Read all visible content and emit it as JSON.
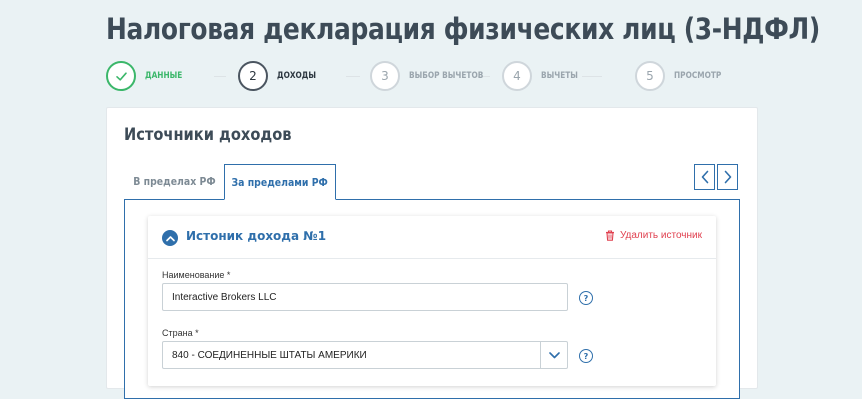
{
  "page": {
    "title": "Налоговая декларация физических лиц (3-НДФЛ)"
  },
  "steps": [
    {
      "number": "✓",
      "label": "ДАННЫЕ",
      "state": "done"
    },
    {
      "number": "2",
      "label": "ДОХОДЫ",
      "state": "active"
    },
    {
      "number": "3",
      "label": "ВЫБОР ВЫЧЕТОВ",
      "state": "pending"
    },
    {
      "number": "4",
      "label": "ВЫЧЕТЫ",
      "state": "pending"
    },
    {
      "number": "5",
      "label": "ПРОСМОТР",
      "state": "pending"
    }
  ],
  "section": {
    "title": "Источники доходов"
  },
  "tabs": [
    {
      "label": "В пределах РФ",
      "active": false
    },
    {
      "label": "За пределами РФ",
      "active": true
    }
  ],
  "income_source": {
    "title": "Истоник дохода №1",
    "delete_label": "Удалить источник",
    "name_label": "Наименование *",
    "name_value": "Interactive Brokers LLC",
    "country_label": "Страна *",
    "country_value": "840 - СОЕДИНЕННЫЕ ШТАТЫ АМЕРИКИ",
    "help_glyph": "?"
  },
  "colors": {
    "accent": "#2f6fab",
    "success": "#3bb76a",
    "danger": "#e0404f"
  }
}
